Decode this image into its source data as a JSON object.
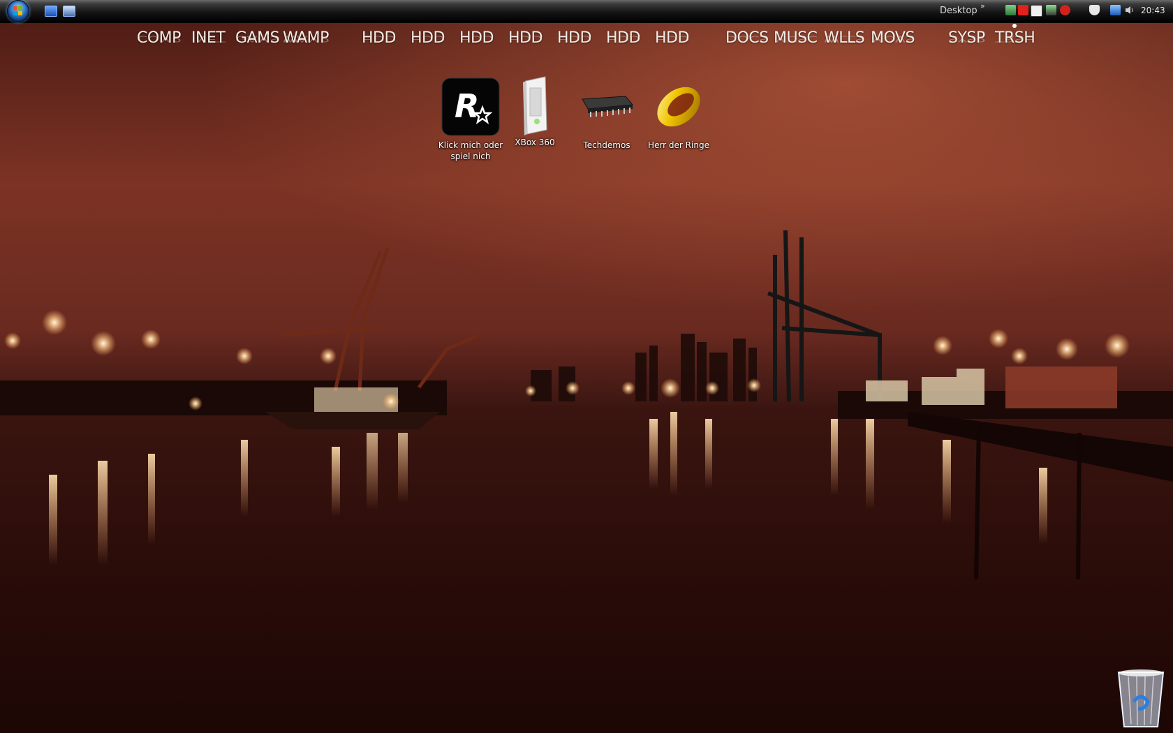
{
  "taskbar": {
    "toolbar_label": "Desktop",
    "toolbar_chevron": "»",
    "clock": "20:43",
    "quick_launch": [
      "show-desktop-icon",
      "switch-windows-icon"
    ],
    "tray_icons": [
      "network-icon",
      "antivirus-icon",
      "window-icon",
      "connection-icon",
      "java-icon",
      "shield-icon",
      "monitor-icon",
      "volume-icon"
    ]
  },
  "dock": {
    "items": [
      {
        "label": "COMP"
      },
      {
        "label": "INET"
      },
      {
        "label": "GAMS"
      },
      {
        "label": "WAMP"
      },
      {
        "label": "HDD"
      },
      {
        "label": "HDD"
      },
      {
        "label": "HDD"
      },
      {
        "label": "HDD"
      },
      {
        "label": "HDD"
      },
      {
        "label": "HDD"
      },
      {
        "label": "HDD"
      },
      {
        "label": "DOCS"
      },
      {
        "label": "MUSC"
      },
      {
        "label": "WLLS"
      },
      {
        "label": "MOVS"
      },
      {
        "label": "SYSP"
      },
      {
        "label": "TRSH"
      }
    ]
  },
  "desktop": {
    "icons": [
      {
        "label": "Klick mich oder spiel nich",
        "icon": "rockstar-icon"
      },
      {
        "label": "XBox 360",
        "icon": "xbox-console-icon"
      },
      {
        "label": "Techdemos",
        "icon": "chip-icon"
      },
      {
        "label": "Herr der Ringe",
        "icon": "gold-ring-icon"
      }
    ],
    "recycle_bin_icon": "recycle-bin-icon"
  },
  "colors": {
    "sky_top": "#3a1410",
    "sky_glow": "#a4503a",
    "water": "#2b0d09",
    "lights": "#ffd9a0"
  }
}
